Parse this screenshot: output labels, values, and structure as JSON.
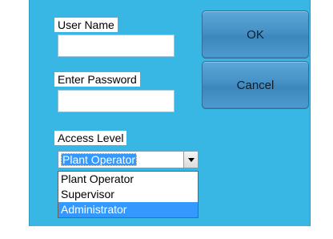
{
  "form": {
    "username_label": "User Name",
    "username_value": "",
    "password_label": "Enter Password",
    "password_value": "",
    "access_label": "Access Level",
    "access_selected": "Plant Operator"
  },
  "buttons": {
    "ok_label": "OK",
    "cancel_label": "Cancel"
  },
  "dropdown": {
    "options": [
      "Plant Operator",
      "Supervisor",
      "Administrator"
    ],
    "highlighted_index": 2
  },
  "colors": {
    "background": "#38b6e4",
    "selection": "#3399ff",
    "button": "#4690c5"
  },
  "icons": {
    "combo_arrow": "chevron-down-icon"
  }
}
